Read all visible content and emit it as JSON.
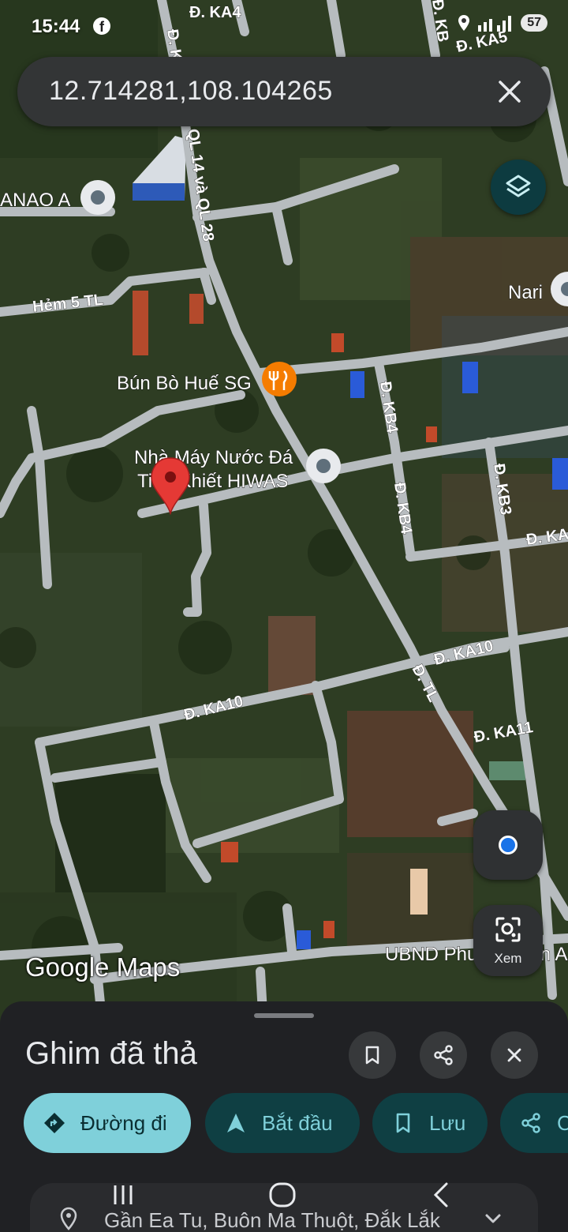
{
  "status_bar": {
    "time": "15:44",
    "battery": "57"
  },
  "search": {
    "query": "12.714281,108.104265"
  },
  "map": {
    "road_labels": [
      "Đ. KA4",
      "Đ. KA5",
      "QL 14 và QL 28",
      "Hẻm 5 TL",
      "Đ. KB4",
      "Đ. KB4",
      "Đ. KB3",
      "Đ. KA10",
      "Đ. KA10",
      "Đ. TL",
      "Đ. KA11",
      "Đ. KA",
      "Đ. KB",
      "Đ. K"
    ],
    "poi_labels": [
      "ANAO A",
      "Nari",
      "Bún Bò Huế SG",
      "Nhà Máy Nước Đá",
      "Tinh Khiết HIWAS",
      "UBND Phường Tân An"
    ],
    "attribution": "Google Maps",
    "lens_label": "Xem"
  },
  "sheet": {
    "title": "Ghim đã thả",
    "actions": {
      "directions": "Đường đi",
      "start": "Bắt đầu",
      "save": "Lưu",
      "share": "Chia sẻ"
    },
    "address": "Gần Ea Tu, Buôn Ma Thuột, Đắk Lắk"
  },
  "colors": {
    "sheet_bg": "#202124",
    "chip_primary": "#7fd0da",
    "chip_secondary": "#0f3f43",
    "pin_red": "#e53935",
    "map_road": "#b7bcbf"
  }
}
